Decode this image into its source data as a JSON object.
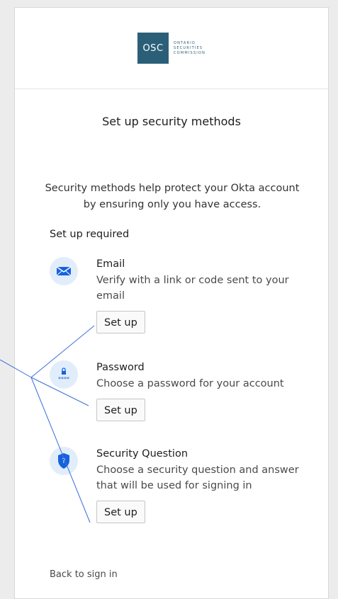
{
  "logo": {
    "abbr": "OSC",
    "line1": "ONTARIO",
    "line2": "SECURITIES",
    "line3": "COMMISSION",
    "color": "#2b5f78"
  },
  "title": "Set up security methods",
  "description": "Security methods help protect your Okta account by ensuring only you have access.",
  "subtitle": "Set up required",
  "methods": [
    {
      "icon": "email-icon",
      "name": "Email",
      "description": "Verify with a link or code sent to your email",
      "button": "Set up"
    },
    {
      "icon": "password-icon",
      "name": "Password",
      "description": "Choose a password for your account",
      "button": "Set up"
    },
    {
      "icon": "security-question-icon",
      "name": "Security Question",
      "description": "Choose a security question and answer that will be used for signing in",
      "button": "Set up"
    }
  ],
  "back_link": "Back to sign in",
  "colors": {
    "icon_bg": "#e1edfa",
    "icon_blue": "#1662dd",
    "annotation_line": "#3a6fd8"
  }
}
